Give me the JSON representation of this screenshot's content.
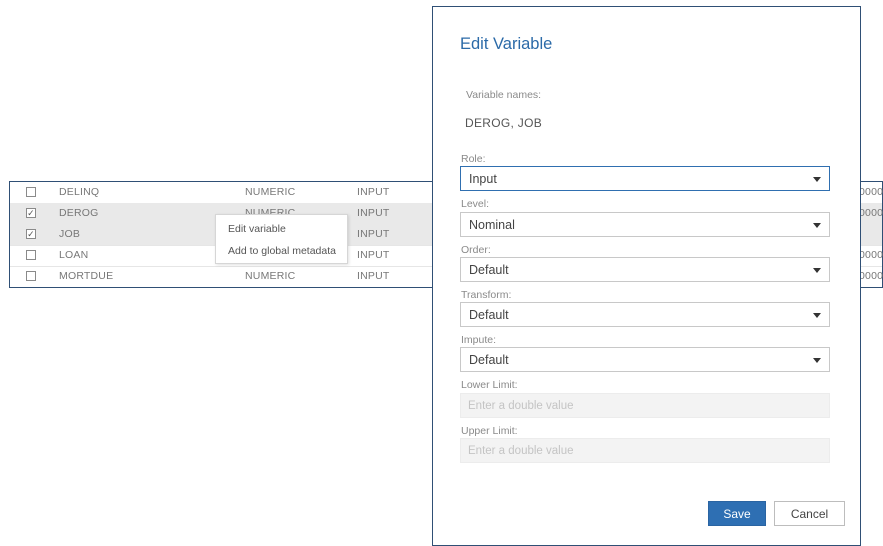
{
  "table": {
    "rows": [
      {
        "checked": false,
        "mark": "",
        "name": "DELINQ",
        "type": "NUMERIC",
        "role": "INPUT",
        "extra": "0000"
      },
      {
        "checked": true,
        "mark": "✓",
        "name": "DEROG",
        "type": "NUMERIC",
        "role": "INPUT",
        "extra": "0000"
      },
      {
        "checked": true,
        "mark": "✓",
        "name": "JOB",
        "type": "",
        "role": "INPUT",
        "extra": ""
      },
      {
        "checked": false,
        "mark": "",
        "name": "LOAN",
        "type": "",
        "role": "INPUT",
        "extra": "0000"
      },
      {
        "checked": false,
        "mark": "",
        "name": "MORTDUE",
        "type": "NUMERIC",
        "role": "INPUT",
        "extra": "0000"
      }
    ]
  },
  "context_menu": {
    "items": [
      "Edit variable",
      "Add to global metadata"
    ]
  },
  "dialog": {
    "title": "Edit Variable",
    "variable_names_label": "Variable names:",
    "variable_names_value": "DEROG, JOB",
    "fields": {
      "role": {
        "label": "Role:",
        "value": "Input"
      },
      "level": {
        "label": "Level:",
        "value": "Nominal"
      },
      "order": {
        "label": "Order:",
        "value": "Default"
      },
      "transform": {
        "label": "Transform:",
        "value": "Default"
      },
      "impute": {
        "label": "Impute:",
        "value": "Default"
      },
      "lower_limit": {
        "label": "Lower Limit:",
        "placeholder": "Enter a double value"
      },
      "upper_limit": {
        "label": "Upper Limit:",
        "placeholder": "Enter a double value"
      }
    },
    "save_label": "Save",
    "cancel_label": "Cancel"
  },
  "colors": {
    "accent": "#2e6fb3",
    "title": "#2b6aa8",
    "border": "#2f4f75",
    "selected_row": "#e9e9e9"
  },
  "icons": [
    "checkbox-icon",
    "dropdown-arrow-icon"
  ]
}
